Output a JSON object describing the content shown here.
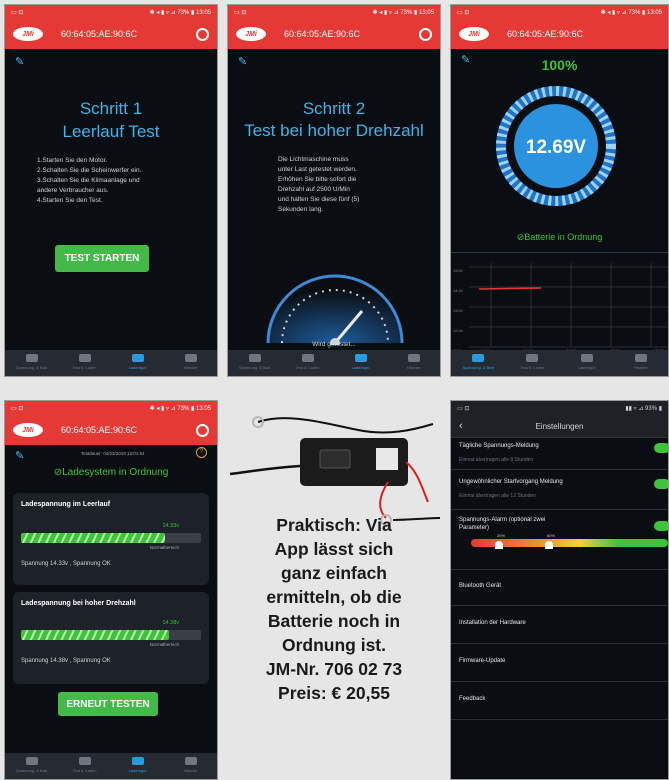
{
  "statusbar": {
    "left": "▭ ⊡",
    "right": "✱ ◂ ▮ ▿ ⊿ 73% ▮ 13:05"
  },
  "device": {
    "mac": "60:64:05:AE:90:6C",
    "logo": "JMi"
  },
  "screen1": {
    "title_line1": "Schritt 1",
    "title_line2": "Leerlauf Test",
    "instructions": [
      "1.Starten Sie den Motor.",
      "2.Schalten Sie die Scheinwerfer ein.",
      "3.Schalten Sie die Klimaanlage und",
      "andere Verbraucher aus.",
      "4.Starten Sie den Test."
    ],
    "button": "TEST STARTEN"
  },
  "screen2": {
    "title_line1": "Schritt 2",
    "title_line2": "Test bei hoher Drehzahl",
    "instructions": [
      "Die Lichtmaschine muss",
      "unter Last getestet werden.",
      "Erhöhen Sie bitte sofort die",
      "Drehzahl auf 2500 U/Min",
      "und halten Sie diese fünf (5)",
      "Sekunden lang."
    ],
    "gauge_text": "Wird getestet..."
  },
  "screen3": {
    "percent": "100%",
    "voltage": "12.69V",
    "status": "Batterie in Ordnung",
    "y_ticks": [
      "15.0v",
      "14.0v",
      "13.0v",
      "12.0v",
      "11.0v"
    ],
    "x_ticks": [
      "14:38",
      "14:49",
      "15:00",
      "15:11",
      "15:22"
    ]
  },
  "nav": {
    "items": [
      "Spannung. & Batt",
      "Test d. Laden",
      "Laderegel",
      "Historie"
    ]
  },
  "screen4": {
    "timestamp": "Testdauer: 04/23/2019 13:01:54",
    "status": "Ladesystem in Ordnung",
    "card1": {
      "title": "Ladespannung im Leerlauf",
      "value": "14.33v",
      "level": 0.8,
      "norm": "Normalbereich",
      "summary": "Spannung 14.33v , Spannung OK"
    },
    "card2": {
      "title": "Ladespannung bei hoher Drehzahl",
      "value": "14.38v",
      "level": 0.82,
      "norm": "Normalbereich",
      "summary": "Spannung 14.38v , Spannung OK"
    },
    "button": "ERNEUT TESTEN"
  },
  "caption": [
    "Praktisch: Via",
    "App lässt sich",
    "ganz einfach",
    "ermitteln, ob die",
    "Batterie noch in",
    "Ordnung ist.",
    "JM-Nr. 706 02 73",
    "Preis: € 20,55"
  ],
  "settings": {
    "status_right": "▮▮ ▿ ⊿ 93% ▮",
    "title": "Einstellungen",
    "rows": [
      {
        "title": "Tägliche Spannungs-Meldung",
        "sub": "Einmal übertragen alle 8 Stunden",
        "toggle": true
      },
      {
        "title": "Ungewöhnlicher Startvorgang Meldung",
        "sub": "Einmal übertragen alle 12 Stunden",
        "toggle": true
      },
      {
        "title": "Spannungs-Alarm (optional zwei",
        "title2": "Parameter)",
        "toggle": true
      },
      {
        "title": "Bluetooth Gerät"
      },
      {
        "title": "Installation der Hardware"
      },
      {
        "title": "Firmware-Update"
      },
      {
        "title": "Feedback"
      }
    ],
    "slider_labels": [
      "20%",
      "60%"
    ]
  }
}
